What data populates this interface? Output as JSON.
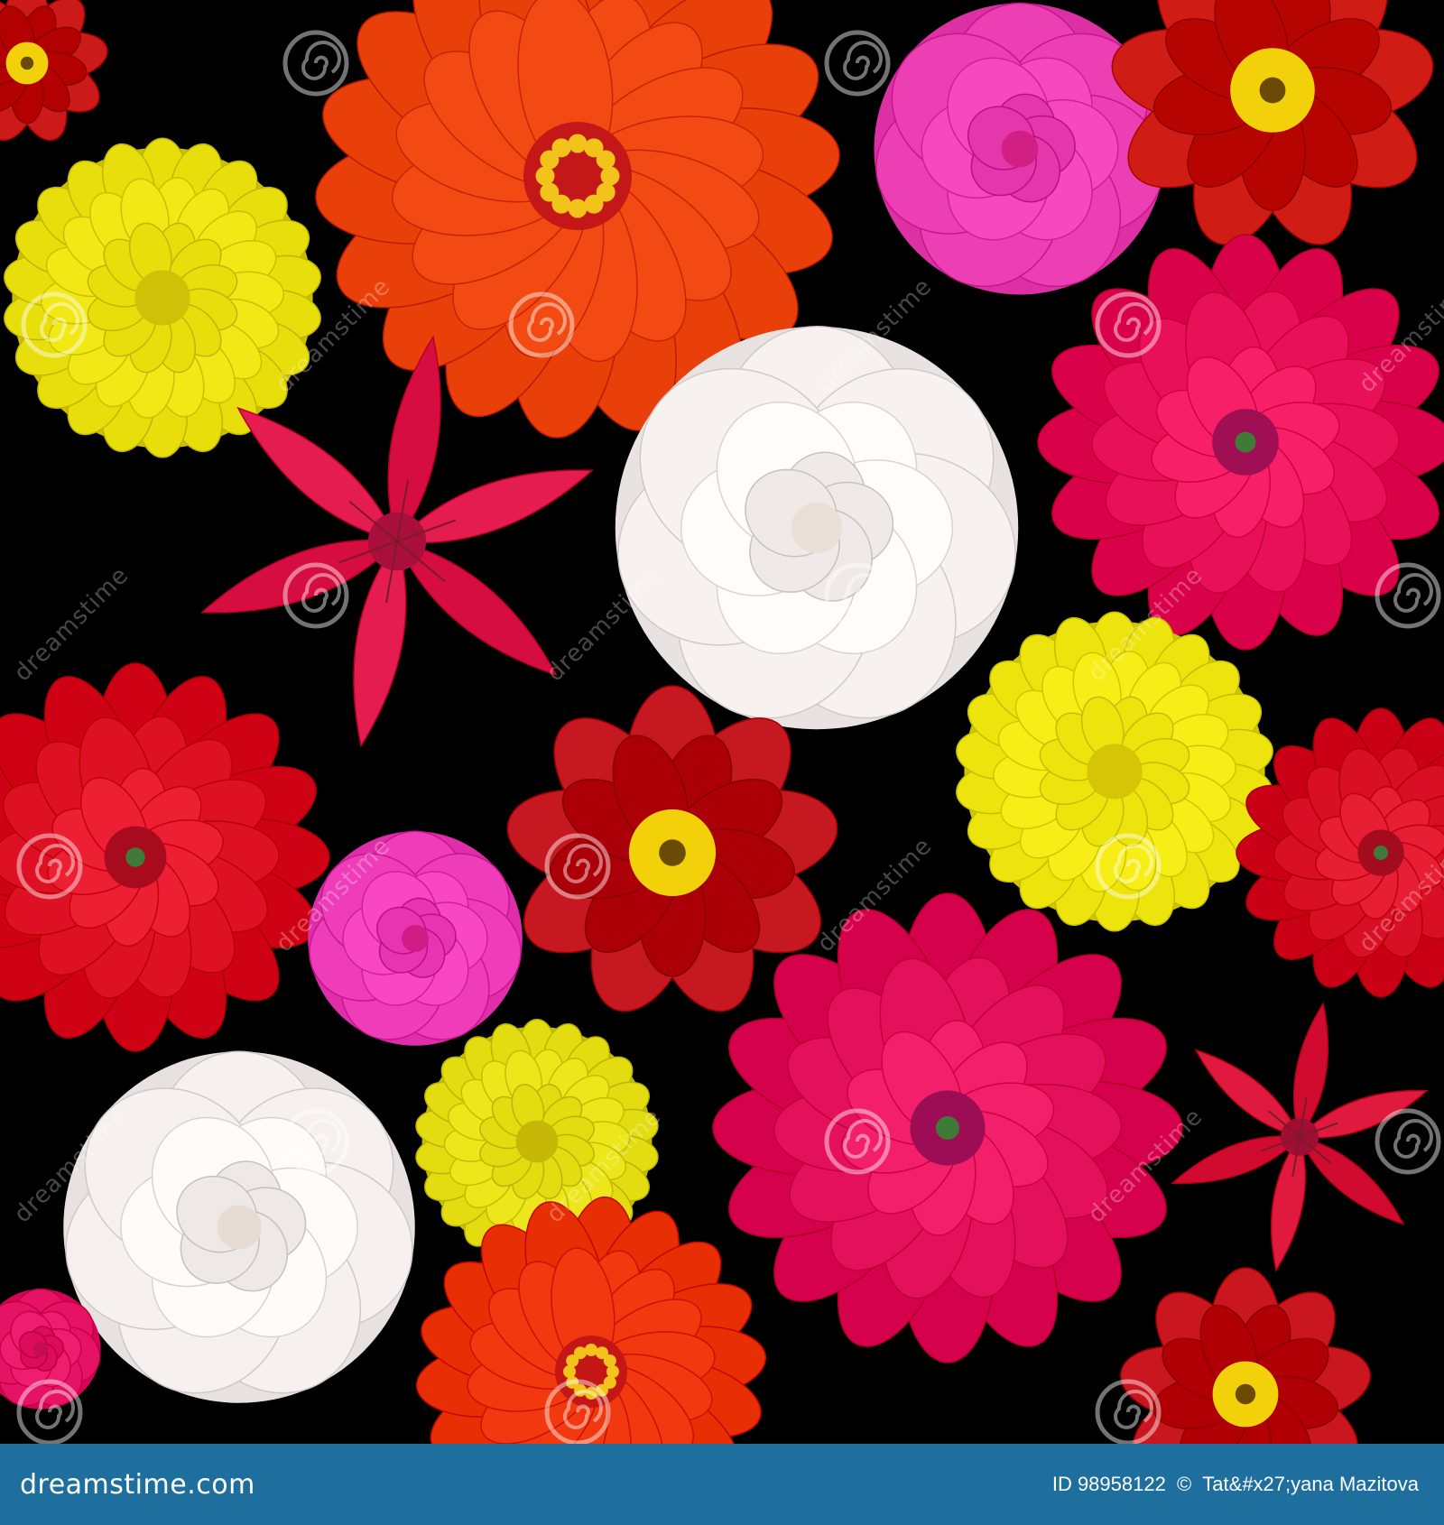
{
  "footer": {
    "logo_text": "dreamstime.com",
    "id_label": "ID 98958122",
    "copyright_symbol": "©",
    "author": "Tat&#x27;yana Mazitova",
    "background_color": "#1f6f9e"
  },
  "watermark": {
    "text": "dreamstime"
  },
  "flowers": [
    {
      "kind": "zinnia",
      "color": "#f24a12",
      "center": "#c41818"
    },
    {
      "kind": "rose",
      "color": "#ec3fb3",
      "center": "#d21f83"
    },
    {
      "kind": "marigold",
      "color": "#cf1d16",
      "center": "#f2d10a"
    },
    {
      "kind": "marigold-yellow",
      "color": "#e8de0c",
      "center": "#cfc008"
    },
    {
      "kind": "lily",
      "color": "#e41c4f",
      "center": "#a80f3c"
    },
    {
      "kind": "rose",
      "color": "#f7f2ef",
      "center": "#e9dfd6"
    },
    {
      "kind": "dahlia",
      "color": "#e9105a",
      "center": "#a00e54"
    },
    {
      "kind": "dahlia",
      "color": "#de1024",
      "center": "#a80b1e"
    },
    {
      "kind": "rose",
      "color": "#ef3dba",
      "center": "#d01d85"
    },
    {
      "kind": "marigold",
      "color": "#c51821",
      "center": "#f2d10a"
    },
    {
      "kind": "marigold-yellow",
      "color": "#ede40d",
      "center": "#d6c506"
    },
    {
      "kind": "dahlia",
      "color": "#d80f25",
      "center": "#a30b1e"
    },
    {
      "kind": "rose",
      "color": "#f6f1ee",
      "center": "#e7dcd3"
    },
    {
      "kind": "marigold-yellow",
      "color": "#e2dc10",
      "center": "#c7b807"
    },
    {
      "kind": "dahlia",
      "color": "#e5105b",
      "center": "#9c0d55"
    },
    {
      "kind": "lily",
      "color": "#e01a3e",
      "center": "#a10e33"
    },
    {
      "kind": "zinnia",
      "color": "#f2380f",
      "center": "#c51616"
    },
    {
      "kind": "marigold",
      "color": "#c9161f",
      "center": "#f2d10a"
    },
    {
      "kind": "marigold",
      "color": "#cc1a1a",
      "center": "#f2d10a"
    },
    {
      "kind": "rose",
      "color": "#e61266",
      "center": "#c40c52"
    }
  ]
}
